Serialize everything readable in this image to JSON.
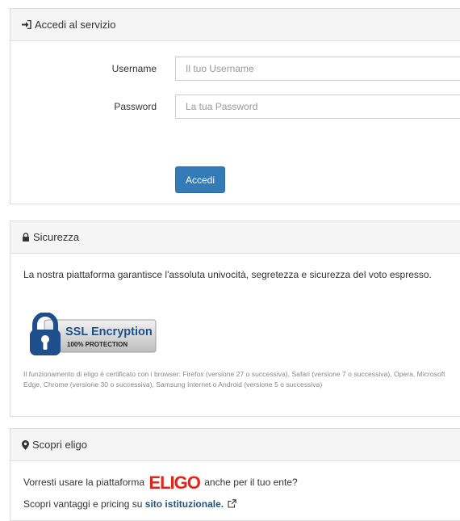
{
  "login": {
    "title": "Accedi al servizio",
    "username_label": "Username",
    "username_placeholder": "Il tuo Username",
    "password_label": "Password",
    "password_placeholder": "La tua Password",
    "submit_label": "Accedi"
  },
  "security": {
    "title": "Sicurezza",
    "description": "La nostra piattaforma garantisce l'assoluta univocità, segretezza e sicurezza del voto espresso.",
    "badge_title": "SSL Encryption",
    "badge_subtitle": "100% PROTECTION",
    "browsers_note": "Il funzionamento di eligo è certificato con i browser: Firefox (versione 27 o successiva), Safari (versione 7 o successiva), Opera, Microsoft Edge, Chrome (versione 30 o successiva), Samsung Internet o Android (versione 5 o successiva)"
  },
  "discover": {
    "title": "Scopri eligo",
    "line1_before": "Vorresti usare la piattaforma",
    "logo_text": "ELIGO",
    "line1_after": "anche per il tuo ente?",
    "line2_before": "Scopri vantaggi e pricing su",
    "line2_link": "sito istituzionale."
  },
  "icons": {
    "login": "sign-in-icon",
    "security": "lock-icon",
    "discover": "map-marker-icon",
    "external": "external-link-icon"
  },
  "colors": {
    "primary": "#337ab7",
    "logo_red": "#e1251b",
    "badge_blue": "#1e4f8a",
    "link": "#23527c"
  }
}
